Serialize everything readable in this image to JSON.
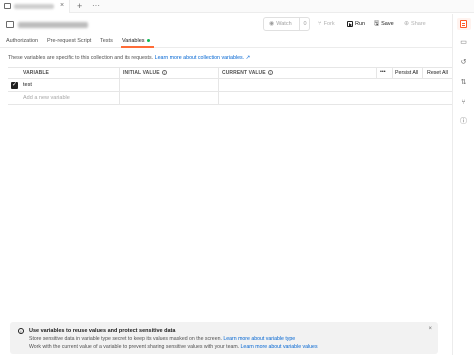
{
  "tab_bar": {
    "close_icon": "×",
    "add_icon": "+",
    "more_icon": "···"
  },
  "header": {
    "watch_label": "Watch",
    "watch_count": "0",
    "fork_label": "Fork",
    "run_label": "Run",
    "save_label": "Save",
    "share_label": "Share"
  },
  "tabs": [
    {
      "label": "Authorization"
    },
    {
      "label": "Pre-request Script"
    },
    {
      "label": "Tests"
    },
    {
      "label": "Variables",
      "indicator": "green-dot"
    }
  ],
  "description": {
    "text": "These variables are specific to this collection and its requests. ",
    "link": "Learn more about collection variables. ↗"
  },
  "table": {
    "headers": {
      "variable": "VARIABLE",
      "initial_value": "INITIAL VALUE",
      "current_value": "CURRENT VALUE",
      "more": "•••",
      "persist_all": "Persist All",
      "reset_all": "Reset All"
    },
    "rows": [
      {
        "checked": true,
        "variable": "test",
        "initial_value": "",
        "current_value": ""
      }
    ],
    "new_row_placeholder": "Add a new variable"
  },
  "banner": {
    "title": "Use variables to reuse values and protect sensitive data",
    "line1_text": "Store sensitive data in variable type secret to keep its values masked on the screen. ",
    "line1_link": "Learn more about variable type",
    "line2_text": "Work with the current value of a variable to prevent sharing sensitive values with your team. ",
    "line2_link": "Learn more about variable values",
    "close_icon": "×"
  },
  "colors": {
    "accent": "#ff6c37",
    "link": "#0265d2",
    "success": "#0cbb52"
  },
  "right_sidebar": {
    "icons": [
      "documentation-icon",
      "comments-icon",
      "history-icon",
      "pull-requests-icon",
      "fork-icon",
      "info-icon"
    ]
  }
}
